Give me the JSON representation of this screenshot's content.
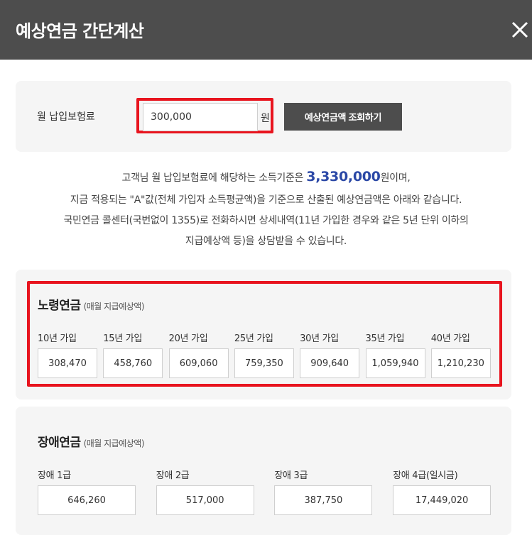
{
  "window": {
    "title": "예상연금 간단계산",
    "close_icon": "close-icon"
  },
  "input_panel": {
    "label": "월 납입보험료",
    "value": "300,000",
    "unit": "원",
    "button_label": "예상연금액 조회하기"
  },
  "description": {
    "line1_prefix": "고객님 월 납입보험료에 해당하는 소득기준은 ",
    "line1_amount": "3,330,000",
    "line1_suffix": "원이며,",
    "line2": "지금 적용되는 \"A\"값(전체 가입자 소득평균액)을 기준으로 산출된 예상연금액은 아래와 같습니다.",
    "line3": "국민연금 콜센터(국번없이 1355)로 전화하시면 상세내역(11년 가입한 경우와 같은 5년 단위 이하의",
    "line4": "지급예상액 등)을 상담받을 수 있습니다."
  },
  "old_age_pension": {
    "title": "노령연금",
    "subtitle": "(매월 지급예상액)",
    "items": [
      {
        "label": "10년 가입",
        "value": "308,470"
      },
      {
        "label": "15년 가입",
        "value": "458,760"
      },
      {
        "label": "20년 가입",
        "value": "609,060"
      },
      {
        "label": "25년 가입",
        "value": "759,350"
      },
      {
        "label": "30년 가입",
        "value": "909,640"
      },
      {
        "label": "35년 가입",
        "value": "1,059,940"
      },
      {
        "label": "40년 가입",
        "value": "1,210,230"
      }
    ]
  },
  "disability_pension": {
    "title": "장애연금",
    "subtitle": "(매월 지급예상액)",
    "items": [
      {
        "label": "장애 1급",
        "value": "646,260"
      },
      {
        "label": "장애 2급",
        "value": "517,000"
      },
      {
        "label": "장애 3급",
        "value": "387,750"
      },
      {
        "label": "장애 4급(일시금)",
        "value": "17,449,020"
      }
    ]
  },
  "colors": {
    "header": "#4d4d4d",
    "highlight": "#2b48a6",
    "red_frame": "#e8141e",
    "panel": "#f5f5f5"
  }
}
